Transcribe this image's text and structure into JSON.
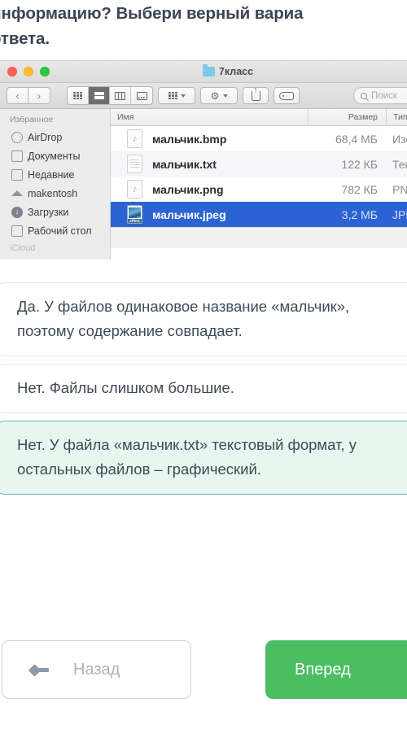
{
  "question": {
    "text": "информацию? Выбери верный вариа\nответа."
  },
  "finder": {
    "window_title": "7класс",
    "folder_icon": "folder-icon",
    "traffic_lights": [
      "close-button",
      "minimize-button",
      "zoom-button"
    ],
    "toolbar": {
      "back_icon": "‹",
      "forward_icon": "›",
      "view_modes": [
        "icon-view",
        "list-view",
        "column-view",
        "gallery-view"
      ],
      "active_view": "list-view",
      "arrange_icon": "arrange-icon",
      "action_icon": "⚙",
      "share_icon": "share-icon",
      "tag_icon": "tag-icon",
      "search_placeholder": "Поиск"
    },
    "sidebar": {
      "header": "Избранное",
      "items": [
        {
          "label": "AirDrop",
          "icon": "airdrop-icon"
        },
        {
          "label": "Документы",
          "icon": "documents-icon"
        },
        {
          "label": "Недавние",
          "icon": "recents-icon"
        },
        {
          "label": "makentosh",
          "icon": "home-icon"
        },
        {
          "label": "Загрузки",
          "icon": "downloads-icon"
        },
        {
          "label": "Рабочий стол",
          "icon": "desktop-icon"
        }
      ],
      "next_section": "iCloud"
    },
    "columns": {
      "name": "Имя",
      "size": "Размер",
      "kind": "Тип"
    },
    "files": [
      {
        "name": "мальчик.bmp",
        "size": "68,4 МБ",
        "kind": "Изоб...BM",
        "icon": "music-file-icon",
        "selected": false
      },
      {
        "name": "мальчик.txt",
        "size": "122 КБ",
        "kind": "Текст",
        "icon": "text-file-icon",
        "selected": false
      },
      {
        "name": "мальчик.png",
        "size": "782 КБ",
        "kind": "PNG",
        "icon": "music-file-icon",
        "selected": false
      },
      {
        "name": "мальчик.jpeg",
        "size": "3,2 МБ",
        "kind": "JPEG",
        "icon": "jpeg-file-icon",
        "selected": true
      }
    ]
  },
  "options": [
    {
      "text": "Да. У файлов одинаковое название «мальчик», поэтому содержание совпадает.",
      "selected": false
    },
    {
      "text": "Нет. Файлы слишком большие.",
      "selected": false
    },
    {
      "text": "Нет. У файла «мальчик.txt» текстовый формат, у остальных файлов – графический.",
      "selected": true
    }
  ],
  "footer": {
    "back_label": "Назад",
    "next_label": "Вперед"
  },
  "colors": {
    "accent_green": "#4cbe62",
    "selected_option_border": "#62b8ab",
    "selected_option_bg": "#e9f6f0",
    "finder_selection_blue": "#2b63d4",
    "heading_text": "#3b4652"
  }
}
